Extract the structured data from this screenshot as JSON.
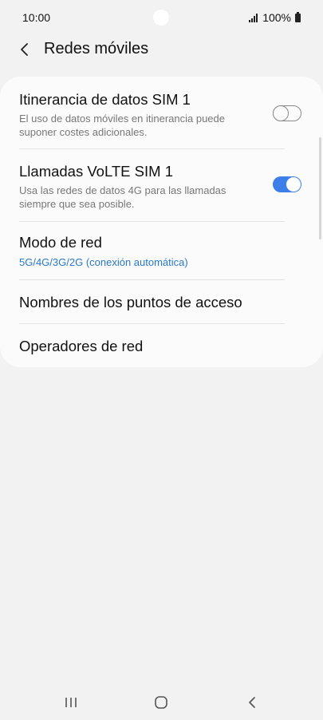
{
  "status_bar": {
    "time": "10:00",
    "battery": "100%"
  },
  "header": {
    "title": "Redes móviles"
  },
  "settings": [
    {
      "title": "Itinerancia de datos SIM 1",
      "description": "El uso de datos móviles en itinerancia puede suponer costes adicionales.",
      "toggle_on": false
    },
    {
      "title": "Llamadas VoLTE SIM 1",
      "description": "Usa las redes de datos 4G para las llamadas siempre que sea posible.",
      "toggle_on": true
    },
    {
      "title": "Modo de red",
      "value": "5G/4G/3G/2G (conexión automática)"
    },
    {
      "title": "Nombres de los puntos de acceso"
    },
    {
      "title": "Operadores de red"
    }
  ],
  "colors": {
    "accent": "#3d7ee8",
    "link_text": "#2b78c7",
    "background": "#f2f2f2",
    "card": "#fbfbfb"
  },
  "icons": {
    "back": "back-arrow-icon",
    "signal": "signal-icon",
    "battery": "battery-icon",
    "nav_recents": "recents-icon",
    "nav_home": "home-icon",
    "nav_back": "nav-back-icon"
  }
}
